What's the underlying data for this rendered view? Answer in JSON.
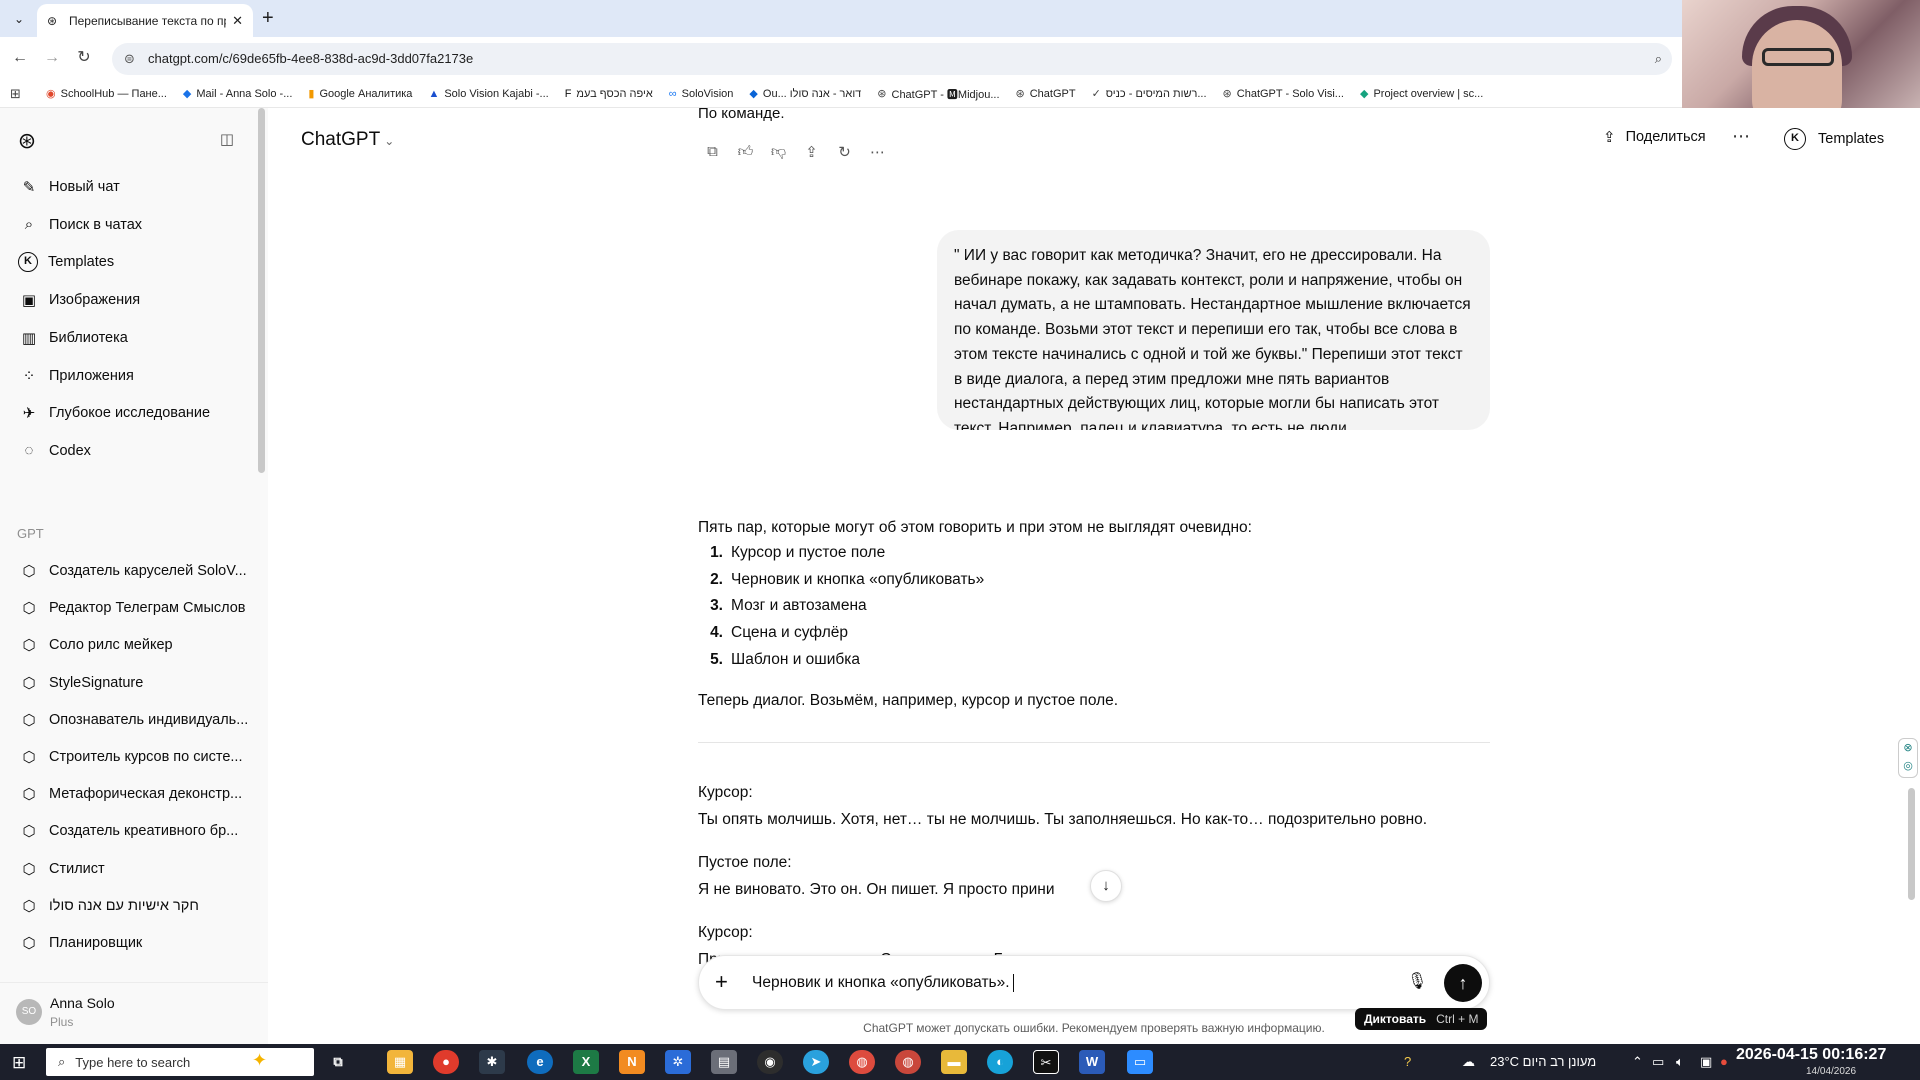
{
  "browser": {
    "tab_title": "Переписывание текста по пр...",
    "new_tab": "+",
    "url": "chatgpt.com/c/69de65fb-4ee8-838d-ac9d-3dd07fa2173e",
    "bookmarks": [
      {
        "label": "SchoolHub — Пане...",
        "icon": "◉",
        "color": "#e0472b"
      },
      {
        "label": "Mail - Anna Solo -...",
        "icon": "◆",
        "color": "#1a73e8"
      },
      {
        "label": "Google Аналитика",
        "icon": "▮",
        "color": "#f29900"
      },
      {
        "label": "Solo Vision Kajabi -...",
        "icon": "▲",
        "color": "#1a4fcf"
      },
      {
        "label": "איפה הכסף בעמ",
        "icon": "F",
        "color": "#111111"
      },
      {
        "label": "SoloVision",
        "icon": "∞",
        "color": "#1877f2"
      },
      {
        "label": "Ou... דואר - אנה סולו",
        "icon": "◆",
        "color": "#0a64d6"
      },
      {
        "label": "ChatGPT - 🅼Midjou...",
        "icon": "⊛",
        "color": "#444444"
      },
      {
        "label": "ChatGPT",
        "icon": "⊛",
        "color": "#444444"
      },
      {
        "label": "רשות המיסים - כניס...",
        "icon": "✓",
        "color": "#444444"
      },
      {
        "label": "ChatGPT - Solo Visi...",
        "icon": "⊛",
        "color": "#444444"
      },
      {
        "label": "Project overview | sc...",
        "icon": "◆",
        "color": "#16a37f"
      }
    ]
  },
  "sidebar": {
    "nav": [
      {
        "label": "Новый чат",
        "icon": "✎"
      },
      {
        "label": "Поиск в чатах",
        "icon": "⌕"
      },
      {
        "label": "Templates",
        "icon": "K"
      },
      {
        "label": "Изображения",
        "icon": "▣"
      },
      {
        "label": "Библиотека",
        "icon": "▥"
      },
      {
        "label": "Приложения",
        "icon": "⁘"
      },
      {
        "label": "Глубокое исследование",
        "icon": "✈"
      },
      {
        "label": "Codex",
        "icon": "◌"
      }
    ],
    "section_label": "GPT",
    "gpts": [
      "Создатель каруселей SoloV...",
      "Редактор Телеграм Смыслов",
      "Соло рилс мейкер",
      "StyleSignature",
      "Опознаватель индивидуаль...",
      "Строитель курсов по систе...",
      "Метафорическая деконстр...",
      "Создатель креативного бр...",
      "Стилист",
      "חקר אישיות עם אנה סולו",
      "Планировщик"
    ],
    "user": {
      "initials": "SO",
      "name": "Anna Solo",
      "plan": "Plus"
    }
  },
  "header": {
    "model": "ChatGPT",
    "share": "Поделиться",
    "templates": "Templates",
    "templates_icon": "K"
  },
  "chat": {
    "prev_tail": "По команде.",
    "user_message": "\" ИИ у вас говорит как методичка? Значит, его не дрессировали. На вебинаре покажу, как задавать контекст, роли и напряжение, чтобы он начал думать, а не штамповать. Нестандартное мышление включается по команде. Возьми этот текст и перепиши его так, чтобы все слова в этом тексте начинались с одной и той же буквы.\" Перепиши этот текст в виде диалога, а перед этим предложи мне пять вариантов нестандартных действующих лиц, которые могли бы написать этот текст. Например, палец и клавиатура, то есть не люди.",
    "answer_intro": "Пять пар, которые могут об этом говорить и при этом не выглядят очевидно:",
    "pairs": [
      {
        "num": "1.",
        "text": "Курсор и пустое поле"
      },
      {
        "num": "2.",
        "text": "Черновик и кнопка «опубликовать»"
      },
      {
        "num": "3.",
        "text": "Мозг и автозамена"
      },
      {
        "num": "4.",
        "text": "Сцена и суфлёр"
      },
      {
        "num": "5.",
        "text": "Шаблон и ошибка"
      }
    ],
    "answer_lead": "Теперь диалог. Возьмём, например, курсор и пустое поле.",
    "dialog": [
      {
        "speaker": "Курсор:",
        "line": "Ты опять молчишь. Хотя, нет… ты не молчишь. Ты заполняешься. Но как-то… подозрительно ровно."
      },
      {
        "speaker": "Пустое поле:",
        "line": "Я не виновато. Это он. Он пишет. Я просто прини"
      },
      {
        "speaker": "Курсор:",
        "line": "Принимаешь методички. Слово в слово. Без вызова."
      }
    ]
  },
  "composer": {
    "value": "Черновик и кнопка «опубликовать».",
    "tooltip_label": "Диктовать",
    "tooltip_shortcut": "Ctrl + M",
    "disclaimer": "ChatGPT может допускать ошибки. Рекомендуем проверять важную информацию."
  },
  "taskbar": {
    "search_placeholder": "Type here to search",
    "weather": "23°C מעונן רב היום",
    "clock_time": "2026-04-15 00:16:27",
    "clock_date": "14/04/2026"
  }
}
